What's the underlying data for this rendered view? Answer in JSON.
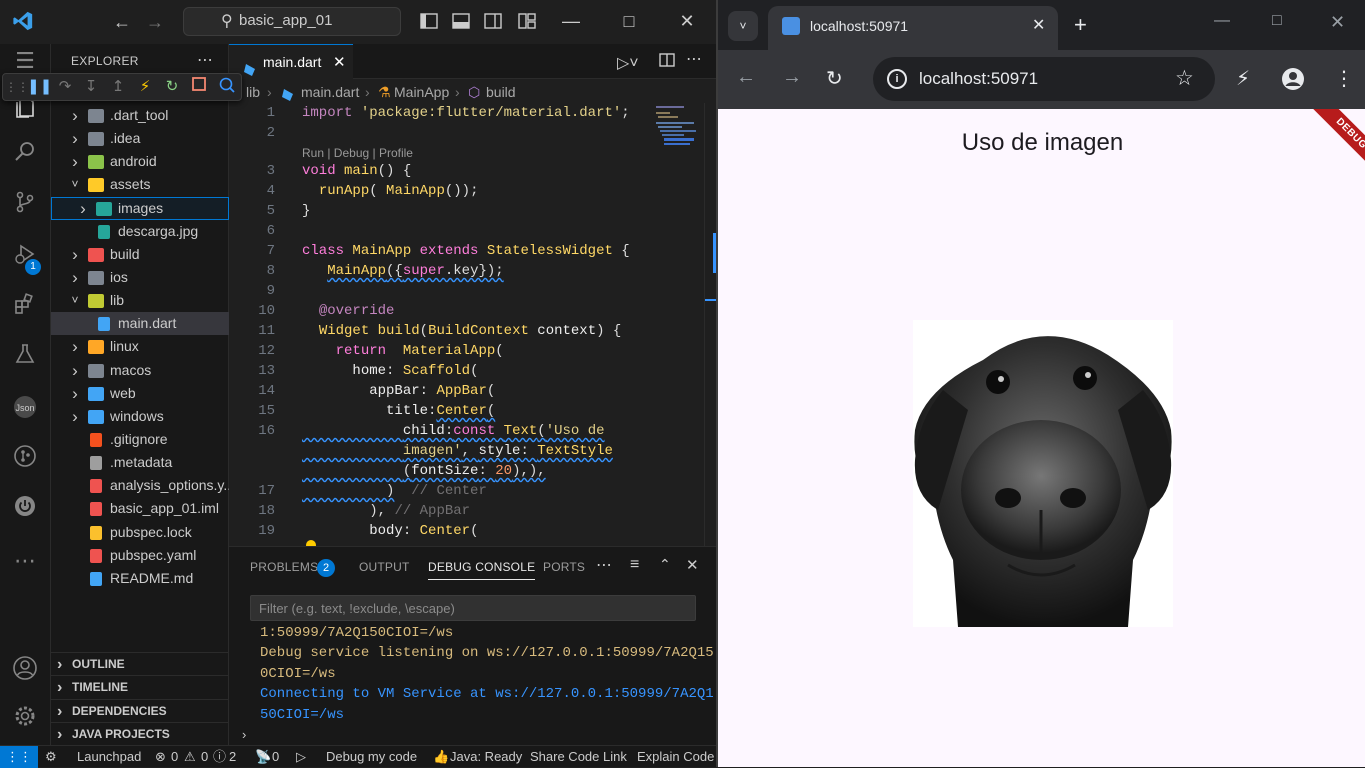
{
  "vscode": {
    "search_text": "basic_app_01",
    "explorer": {
      "title": "EXPLORER",
      "tree": [
        {
          "name": ".dart_tool",
          "type": "folder",
          "expanded": false,
          "color": "#7d8590"
        },
        {
          "name": ".idea",
          "type": "folder",
          "expanded": false,
          "color": "#7d8590"
        },
        {
          "name": "android",
          "type": "folder",
          "expanded": false,
          "color": "#8bc34a"
        },
        {
          "name": "assets",
          "type": "folder",
          "expanded": true,
          "color": "#ffca28"
        },
        {
          "name": "images",
          "type": "folder",
          "expanded": false,
          "color": "#26a69a"
        },
        {
          "name": "descarga.jpg",
          "type": "file",
          "color": "#26a69a"
        },
        {
          "name": "build",
          "type": "folder",
          "expanded": false,
          "color": "#ef5350"
        },
        {
          "name": "ios",
          "type": "folder",
          "expanded": false,
          "color": "#7d8590"
        },
        {
          "name": "lib",
          "type": "folder",
          "expanded": true,
          "color": "#c0ca33"
        },
        {
          "name": "main.dart",
          "type": "file",
          "color": "#42a5f5"
        },
        {
          "name": "linux",
          "type": "folder",
          "expanded": false,
          "color": "#ffa726"
        },
        {
          "name": "macos",
          "type": "folder",
          "expanded": false,
          "color": "#7d8590"
        },
        {
          "name": "web",
          "type": "folder",
          "expanded": false,
          "color": "#42a5f5"
        },
        {
          "name": "windows",
          "type": "folder",
          "expanded": false,
          "color": "#42a5f5"
        },
        {
          "name": ".gitignore",
          "type": "file",
          "color": "#f4511e"
        },
        {
          "name": ".metadata",
          "type": "file",
          "color": "#9e9e9e"
        },
        {
          "name": "analysis_options.y...",
          "type": "file",
          "color": "#ef5350"
        },
        {
          "name": "basic_app_01.iml",
          "type": "file",
          "color": "#ef5350"
        },
        {
          "name": "pubspec.lock",
          "type": "file",
          "color": "#fbc02d"
        },
        {
          "name": "pubspec.yaml",
          "type": "file",
          "color": "#ef5350"
        },
        {
          "name": "README.md",
          "type": "file",
          "color": "#42a5f5"
        }
      ],
      "sections": [
        "OUTLINE",
        "TIMELINE",
        "DEPENDENCIES",
        "JAVA PROJECTS"
      ]
    },
    "debug_badge": "1",
    "editor": {
      "tab_label": "main.dart",
      "breadcrumb": [
        "lib",
        "main.dart",
        "MainApp",
        "build"
      ],
      "code_lens": "Run | Debug | Profile",
      "line_numbers": [
        "1",
        "2",
        "3",
        "4",
        "5",
        "6",
        "7",
        "8",
        "9",
        "10",
        "11",
        "12",
        "13",
        "14",
        "15",
        "16",
        "17",
        "18",
        "19"
      ]
    },
    "panel": {
      "tabs": [
        "PROBLEMS",
        "OUTPUT",
        "DEBUG CONSOLE",
        "PORTS"
      ],
      "problems_count": "2",
      "filter_placeholder": "Filter (e.g. text, !exclude, \\escape)",
      "output_lines": [
        {
          "text": "1:50999/7A2Q150CIOI=/ws",
          "color": "#d7ba7d"
        },
        {
          "text": "Debug service listening on ws://127.0.0.1:50999/7A2Q15",
          "color": "#d7ba7d"
        },
        {
          "text": "0CIOI=/ws",
          "color": "#d7ba7d"
        },
        {
          "text": "Connecting to VM Service at ws://127.0.0.1:50999/7A2Q1",
          "color": "#3794ff"
        },
        {
          "text": "50CIOI=/ws",
          "color": "#3794ff"
        }
      ]
    },
    "status": {
      "launchpad": "Launchpad",
      "errors": "0",
      "warnings": "0",
      "infos": "2",
      "ports": "0",
      "debug": "Debug my code",
      "java": "Java: Ready",
      "share": "Share Code Link",
      "explain": "Explain Code"
    }
  },
  "browser": {
    "tab_title": "localhost:50971",
    "url": "localhost:50971",
    "app_title": "Uso de imagen",
    "debug_banner": "DEBUG"
  }
}
